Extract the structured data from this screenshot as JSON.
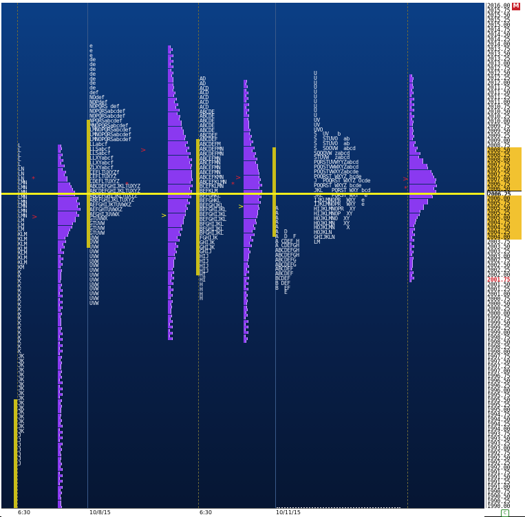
{
  "window": {
    "close_label": "M",
    "status_icon": "C"
  },
  "price_scale": {
    "ticks": [
      "2016.00",
      "2015.75",
      "2015.50",
      "2015.25",
      "2015.00",
      "2014.75",
      "2014.50",
      "2014.25",
      "2014.00",
      "2013.75",
      "2013.50",
      "2013.25",
      "2013.00",
      "2012.75",
      "2012.50",
      "2012.25",
      "2012.00",
      "2011.75",
      "2011.50",
      "2011.25",
      "2011.00",
      "2010.75",
      "2010.50",
      "2010.25",
      "2010.00",
      "2009.75",
      "2009.50",
      "2009.25",
      "2009.00",
      "2008.75",
      "2008.50",
      "2008.25",
      "2008.00",
      "2007.75",
      "2007.50",
      "2007.25",
      "2007.00",
      "2006.75",
      "2006.50",
      "2006.25",
      "2006.00",
      "2005.75",
      "2005.50",
      "2005.25",
      "2005.00",
      "2004.75",
      "2004.50",
      "2004.25",
      "2004.00",
      "2003.75",
      "2003.50",
      "2003.25",
      "2003.00",
      "2002.75",
      "2002.50",
      "2002.25",
      "2002.00",
      "2001.75",
      "2001.50",
      "2001.25",
      "2001.00",
      "2000.75",
      "2000.50",
      "2000.25",
      "2000.00",
      "1999.75",
      "1999.50",
      "1999.25",
      "1999.00",
      "1998.75",
      "1998.50",
      "1998.25",
      "1998.00",
      "1997.75",
      "1997.50",
      "1997.25",
      "1997.00",
      "1996.75",
      "1996.50",
      "1996.25",
      "1996.00",
      "1995.75",
      "1995.50",
      "1995.25",
      "1995.00",
      "1994.75",
      "1994.50",
      "1994.25",
      "1994.00",
      "1993.75",
      "1993.50",
      "1993.25",
      "1993.00",
      "1992.75",
      "1992.50",
      "1992.25",
      "1992.00",
      "1991.75",
      "1991.50",
      "1991.25",
      "1991.00",
      "1990.75",
      "1990.50",
      "1990.25",
      "1990.00"
    ],
    "highlight_range": [
      "2008.50",
      "2004.00"
    ],
    "last_price": "2006.25",
    "red_price": "2001.75"
  },
  "x_axis": {
    "labels": [
      "6:30",
      "10/8/15",
      "6:30",
      "10/11/15"
    ]
  },
  "profiles": [
    {
      "letters": "L\nL\nL\nL\nL\nLN\nLN\nLN\nLMN\nLMN\nLMN\nLMN\nLMN\nLMN\nLMN\nLMN\nLM\nLM\nLM\nKLM\nKLM\nKLM\nKLM\nKLM\nKLM\nKLM\nKM\nK\nK\nK\nK\nK\nK\nK\nK\nK\nK\nK\nK\nK\nK\nK\nK\nK\nK\nJK\nJK\nJK\nJK\nJK\nJK\nJK\nJK\nJK\nJK\nJK\nJK\nJK\nJK\nJK\nJK\nJK\nJ\nJ\nJ\nJ\nJ\nJ\nJ"
    },
    {
      "letters": "e\ne\ne\nde\nde\nde\nde\nde\nde\nde\ndef\nNOdef\nNOPdef\nNOPQRS def\nNOPQRSabcdef\nNOPQRSabcdef\nNPQRSabcdef\nMNOPQRSabcdef\nLMNOPQRSabcdef\nLMNOPQRSabcdef\nLMNOPQRSabcdef\nLLabcf\nLLSabcf\nLLSabcf\nLLXYabcf\nLLXYabcf\nZLXYabcf\nCEFLTUXYZf\nCEFLTUXYZ\nCDEFLTUXYZ\nABCDEFGHIJKLTUXYZ\nABCDEFGHIJKLTUXYZ\nABDEFGHIJKLTUXYZ\nABEFGHIJKLTUXYZ\nAEFGHIJKTUVWXZ\nAEFGHTUVWXZ\nAFGHIJUVWX\nGTUVWX\nGTUVW\nGTUVW\nGTUVW\nUVW\nUVW\nUVW\nUVW\nUVW\nUVW\nUVW\nUVW\nUVW\nUVW\nUVW\nUVW\nUVW\nUVW\nUVW"
    },
    {
      "letters": "AD\nAD\nACD\nACD\nACD\nACD\nACD\nABCDE\nABCDE\nABCDE\nABCDE\nABCDE\nABCDEF\nABCDEF\nABCDEFM\nABCDEFMN\nABCDEFMN\nABCEFMN\nABCEFMN\nABCEFMN\nABCEFMN\nABCEFKMN\nABCEFKLMN\nBCEFKLMN\nBEFKLM\nBEFGHKL\nBEFGHKL\nBEFGHJKL\nBEFGHIJKL\nBEFGHIJKL\nBEFGHIJKL\nBFGHIJKL\nBFGHIJKL\nBFGHIJKL\nFGHIJK\nGHIJK\nGHIJK\nGHIJ\nHIJ\nHIJ\nHIJ\nHIJ\nHI\nHI\nH\nH\nH\nH"
    },
    {
      "letters": "U\nU\nU\nU\nU\nU\nU\nU\nU\nU\nUV\nUV\nUVO\nS  UV   b\nS  STUVO  ab\nS  STUVO  ab\nS  SOOVW  abcd\nSQQQVW zabcd\nSTUVW  zabcd\nPQRSTUVWYYZabcd\nPQQSTVWWXYZabcd\nPOQSTVWXYZabcde\nPOQRST WXYZ bcde\nJ  POQRST WXYZ Ocde\nPOQRST WXYZ bcde\nJKL   PQRST WXY bcd\nJKL   PQRST WXY  e\nIJKLMNOPR  WXY  e\nIJKLMNOPR  WXY  e\nHIJKLMNOPR  XY\nHIJKLMNOP  XY\nHOJKLMNO  XY\nHOJKLMN   XY\nHOJKLMN    X\nHOJKLN\nGHIJKLN\nLM"
    },
    {
      "letters": "A\nA\nA\nA\nA\nA  D\nA  D  F\nA CDEF H\nA CDEFGH\nABCDEFGH\nABCDEFGH\nABCDEFG\nABCDEFG\nABCDEF\nABCDEF\nBCDEF\nB DEF\nB  EF\n   E"
    }
  ]
}
